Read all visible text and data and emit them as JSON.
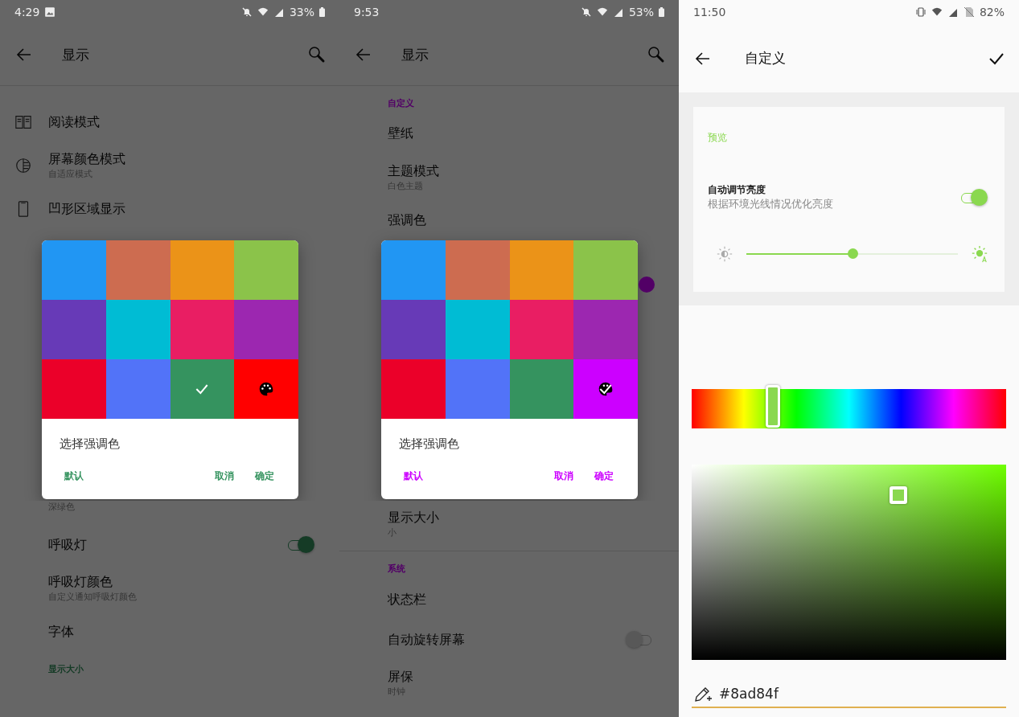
{
  "screens": [
    {
      "kind": "settings",
      "color": "#35935f",
      "status_bar": {
        "time": "4:29",
        "battery": "33%",
        "photo_notification": true
      },
      "title": "显示",
      "rows_top": [
        {
          "kind": "spacer"
        },
        {
          "kind": "icon-item",
          "title": "阅读模式"
        },
        {
          "kind": "icon-item",
          "title": "屏幕颜色模式",
          "subtitle": "自适应模式"
        },
        {
          "kind": "icon-item",
          "title": "凹形区域显示"
        }
      ],
      "dialog": {
        "tiles": [
          {
            "color": "#2196f3",
            "kind": "swatch",
            "selected": false
          },
          {
            "color": "#cd6c50",
            "kind": "swatch",
            "selected": false
          },
          {
            "color": "#eb9318",
            "kind": "swatch",
            "selected": false
          },
          {
            "color": "#8bc34a",
            "kind": "swatch",
            "selected": false
          },
          {
            "color": "#673ab7",
            "kind": "swatch",
            "selected": false
          },
          {
            "color": "#00bcd4",
            "kind": "swatch",
            "selected": false
          },
          {
            "color": "#e91e63",
            "kind": "swatch",
            "selected": false
          },
          {
            "color": "#9c27b0",
            "kind": "swatch",
            "selected": false
          },
          {
            "color": "#eb0029",
            "kind": "swatch",
            "selected": false
          },
          {
            "color": "#5273f8",
            "kind": "swatch",
            "selected": false
          },
          {
            "color": "#35935f",
            "kind": "swatch",
            "selected": true
          },
          {
            "color": "#ff0000",
            "kind": "custom",
            "selected": false
          }
        ],
        "title": "选择强调色",
        "buttons": [
          "默认",
          "取消",
          "确定"
        ]
      },
      "rows_bottom": [
        {
          "kind": "item",
          "subtitle": "深绿色"
        },
        {
          "kind": "toggle",
          "title": "呼吸灯",
          "on": true
        },
        {
          "kind": "item",
          "title": "呼吸灯颜色",
          "subtitle": "自定义通知呼吸灯颜色"
        },
        {
          "kind": "item",
          "title": "字体"
        },
        {
          "kind": "section",
          "title": "显示大小"
        }
      ]
    },
    {
      "kind": "settings",
      "color": "#cc00ff",
      "status_bar": {
        "time": "9:53",
        "battery": "53%"
      },
      "title": "显示",
      "rows_top": [
        {
          "kind": "section",
          "title": "自定义"
        },
        {
          "kind": "item",
          "title": "壁纸"
        },
        {
          "kind": "item",
          "title": "主题模式",
          "subtitle": "白色主题"
        },
        {
          "kind": "item",
          "title": "强调色"
        }
      ],
      "dialog": {
        "tiles": [
          {
            "color": "#2196f3",
            "kind": "swatch",
            "selected": false
          },
          {
            "color": "#cd6c50",
            "kind": "swatch",
            "selected": false
          },
          {
            "color": "#eb9318",
            "kind": "swatch",
            "selected": false
          },
          {
            "color": "#8bc34a",
            "kind": "swatch",
            "selected": false
          },
          {
            "color": "#673ab7",
            "kind": "swatch",
            "selected": false
          },
          {
            "color": "#00bcd4",
            "kind": "swatch",
            "selected": false
          },
          {
            "color": "#e91e63",
            "kind": "swatch",
            "selected": false
          },
          {
            "color": "#9c27b0",
            "kind": "swatch",
            "selected": false
          },
          {
            "color": "#eb0029",
            "kind": "swatch",
            "selected": false
          },
          {
            "color": "#5273f8",
            "kind": "swatch",
            "selected": false
          },
          {
            "color": "#35935f",
            "kind": "swatch",
            "selected": false
          },
          {
            "color": "#cc00ff",
            "kind": "custom",
            "selected": true
          }
        ],
        "title": "选择强调色",
        "buttons": [
          "默认",
          "取消",
          "确定"
        ],
        "behind_toggle_on": true
      },
      "rows_bottom": [
        {
          "kind": "item",
          "title": "显示大小",
          "subtitle": "小"
        },
        {
          "kind": "divider"
        },
        {
          "kind": "section",
          "title": "系统"
        },
        {
          "kind": "item",
          "title": "状态栏"
        },
        {
          "kind": "toggle",
          "title": "自动旋转屏幕",
          "on": false
        },
        {
          "kind": "item",
          "title": "屏保",
          "subtitle": "时钟"
        }
      ]
    },
    {
      "kind": "color-picker",
      "color": "#8ad84f",
      "status_bar": {
        "time": "11:50",
        "battery": "82%"
      },
      "title": "自定义",
      "preview": {
        "label": "预览",
        "title": "自动调节亮度",
        "subtitle": "根据环境光线情况优化亮度",
        "on": true,
        "level": 0.5
      },
      "hue": {
        "level": 0.26
      },
      "hex": "#8ad84f"
    }
  ]
}
